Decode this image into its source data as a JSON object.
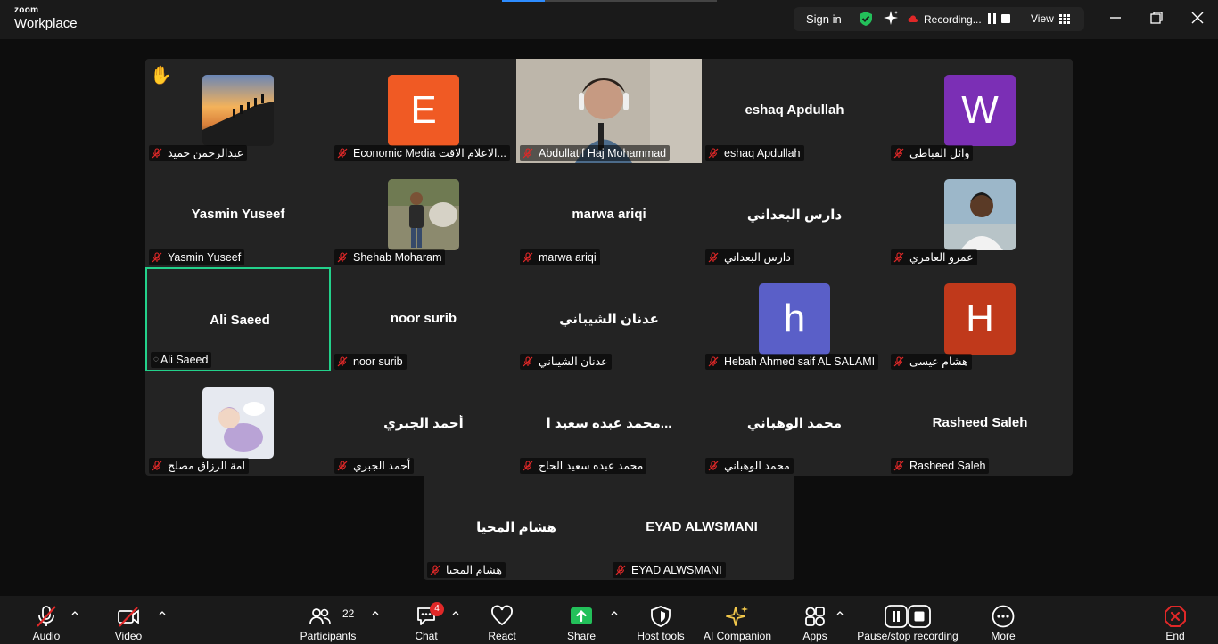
{
  "app": {
    "brand_top": "zoom",
    "brand_bottom": "Workplace"
  },
  "status": {
    "sign_in": "Sign in",
    "recording": "Recording...",
    "view": "View"
  },
  "colors": {
    "accent_green": "#23d18b",
    "record_red": "#e02828",
    "share_green": "#23c05a",
    "ai_gold": "#f2c84b",
    "tile_bg": "#232323"
  },
  "progress": {
    "top_bar_fraction": 0.2
  },
  "tiles": [
    {
      "label": "عبدالرحمن حميد",
      "center": "",
      "icon": "hand-raised-icon"
    },
    {
      "label": "Economic Media الاعلام الاقت...",
      "center": "",
      "avatar": "E"
    },
    {
      "label": "Abdullatif Haj Mohammad",
      "center": ""
    },
    {
      "label": "eshaq Apdullah",
      "center": "eshaq Apdullah"
    },
    {
      "label": "وائل القباطي",
      "center": "",
      "avatar": "W"
    },
    {
      "label": "Yasmin Yuseef",
      "center": "Yasmin Yuseef"
    },
    {
      "label": "Shehab Moharam",
      "center": ""
    },
    {
      "label": "marwa ariqi",
      "center": "marwa ariqi"
    },
    {
      "label": "دارس البعداني",
      "center": "دارس البعداني"
    },
    {
      "label": "عمرو العامري",
      "center": ""
    },
    {
      "label": "Ali Saeed",
      "center": "Ali Saeed"
    },
    {
      "label": "noor surib",
      "center": "noor surib"
    },
    {
      "label": "عدنان الشيباني",
      "center": "عدنان الشيباني"
    },
    {
      "label": "Hebah Ahmed saif AL SALAMI",
      "center": "",
      "avatar": "h"
    },
    {
      "label": "هشام عيسى",
      "center": "",
      "avatar": "H"
    },
    {
      "label": "امة الرزاق مصلح",
      "center": ""
    },
    {
      "label": "أحمد الجبري",
      "center": "أحمد الجبري"
    },
    {
      "label": "محمد عبده سعيد الحاج",
      "center": "محمد عبده سعيد ا..."
    },
    {
      "label": "محمد الوهباني",
      "center": "محمد الوهباني"
    },
    {
      "label": "Rasheed Saleh",
      "center": "Rasheed Saleh"
    },
    {
      "label": "هشام المحيا",
      "center": "هشام المحيا"
    },
    {
      "label": "EYAD ALWSMANI",
      "center": "EYAD ALWSMANI"
    }
  ],
  "toolbar": {
    "audio": "Audio",
    "video": "Video",
    "participants": "Participants",
    "participants_count": "22",
    "chat": "Chat",
    "chat_badge": "4",
    "react": "React",
    "share": "Share",
    "host_tools": "Host tools",
    "ai_companion": "AI Companion",
    "apps": "Apps",
    "pause_recording": "Pause/stop recording",
    "more": "More",
    "end": "End"
  }
}
